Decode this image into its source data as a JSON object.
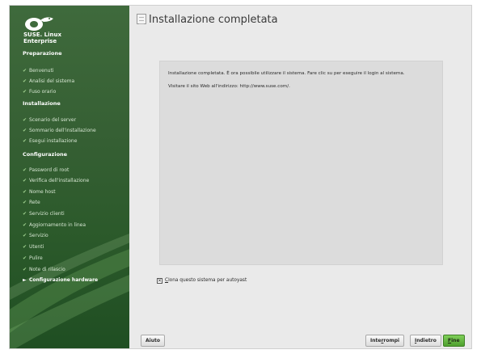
{
  "brand": {
    "line1": "SUSE. Linux",
    "line2": "Enterprise"
  },
  "sections": [
    {
      "title": "Preparazione",
      "steps": [
        "Benvenuti",
        "Analisi del sistema",
        "Fuso orario"
      ]
    },
    {
      "title": "Installazione",
      "steps": [
        "Scenario del server",
        "Sommario dell'installazione",
        "Esegui installazione"
      ]
    },
    {
      "title": "Configurazione",
      "steps": [
        "Password di root",
        "Verifica dell'installazione",
        "Nome host",
        "Rete",
        "Servizio clienti",
        "Aggiornamento in linea",
        "Servizio",
        "Utenti",
        "Pulire",
        "Note di rilascio",
        "Configurazione hardware"
      ]
    }
  ],
  "active_step": "Configurazione hardware",
  "page": {
    "title": "Installazione completata"
  },
  "content": {
    "line1": "Installazione completata. È ora possibile utilizzare il sistema. Fare clic su per eseguire il login al sistema.",
    "line2": "Visitare il sito Web all'indirizzo: http://www.suse.com/."
  },
  "clone_checkbox": {
    "label_underlined": "C",
    "label_rest": "lona questo sistema per autoyast",
    "checked": true
  },
  "buttons": {
    "help": "Aiuto",
    "abort_a": "Inte",
    "abort_u": "r",
    "abort_b": "rompi",
    "back_u": "I",
    "back_b": "ndietro",
    "finish_u": "F",
    "finish_b": "ine"
  },
  "colors": {
    "sidebar": "#355f33",
    "accent": "#5fb33a"
  }
}
